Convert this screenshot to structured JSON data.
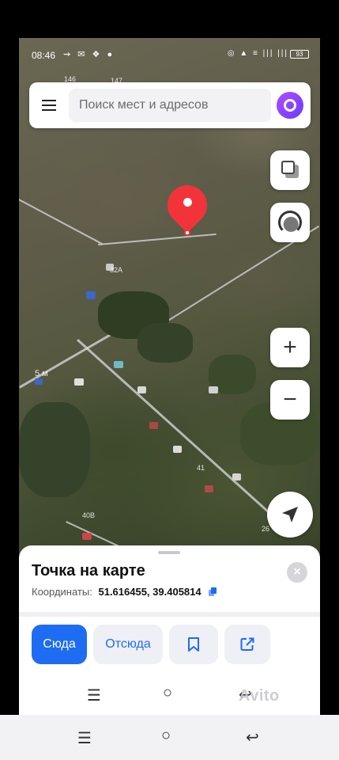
{
  "status_bar": {
    "time": "08:46",
    "left_icons": "⇝ ✉ ❖ ●",
    "right_icons": "◎ ▲ ≡ ||| ||| ",
    "battery": "93"
  },
  "search": {
    "placeholder": "Поиск мест и адресов"
  },
  "map_labels": [
    "146",
    "147",
    "32А",
    "5 м",
    "40В",
    "41",
    "26"
  ],
  "place": {
    "title": "Точка на карте",
    "coords_label": "Координаты:",
    "coords_value": "51.616455, 39.405814"
  },
  "actions": {
    "here": "Сюда",
    "from": "Отсюда"
  },
  "watermark": "Avito",
  "colors": {
    "accent": "#1e6cf2",
    "pin": "#f2343a",
    "alice": "#7a3cff"
  }
}
